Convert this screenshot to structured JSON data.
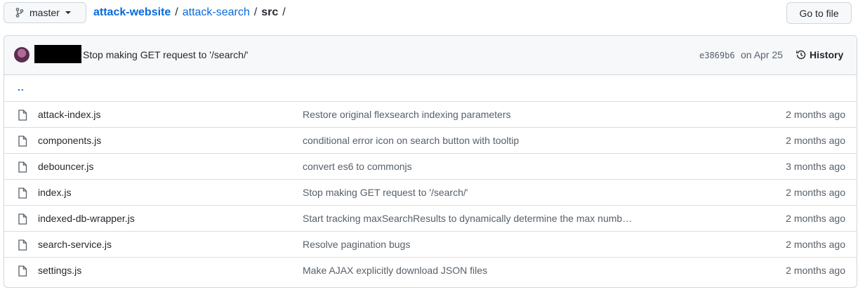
{
  "header": {
    "branch": "master",
    "breadcrumb": {
      "repo": "attack-website",
      "folder": "attack-search",
      "current": "src"
    },
    "go_to_file": "Go to file"
  },
  "commit": {
    "message": "Stop making GET request to '/search/'",
    "sha": "e3869b6",
    "date": "on Apr 25",
    "history_label": "History"
  },
  "parent_dir": "..",
  "files": [
    {
      "name": "attack-index.js",
      "message": "Restore original flexsearch indexing parameters",
      "age": "2 months ago"
    },
    {
      "name": "components.js",
      "message": "conditional error icon on search button with tooltip",
      "age": "2 months ago"
    },
    {
      "name": "debouncer.js",
      "message": "convert es6 to commonjs",
      "age": "3 months ago"
    },
    {
      "name": "index.js",
      "message": "Stop making GET request to '/search/'",
      "age": "2 months ago"
    },
    {
      "name": "indexed-db-wrapper.js",
      "message": "Start tracking maxSearchResults to dynamically determine the max numb…",
      "age": "2 months ago"
    },
    {
      "name": "search-service.js",
      "message": "Resolve pagination bugs",
      "age": "2 months ago"
    },
    {
      "name": "settings.js",
      "message": "Make AJAX explicitly download JSON files",
      "age": "2 months ago"
    }
  ]
}
